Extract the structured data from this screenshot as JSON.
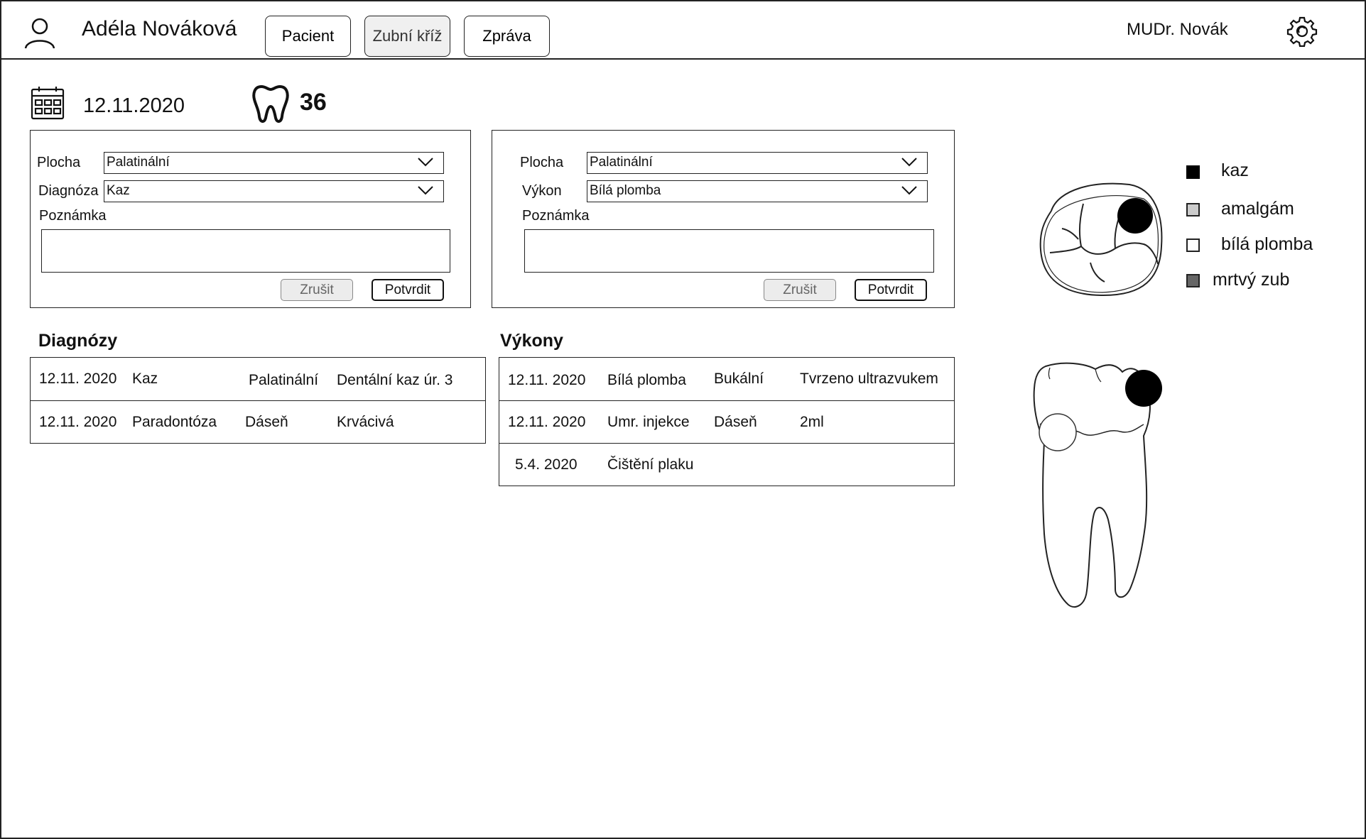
{
  "header": {
    "patient_name": "Adéla Nováková",
    "tabs": [
      {
        "label": "Pacient",
        "active": false
      },
      {
        "label": "Zubní kříž",
        "active": true
      },
      {
        "label": "Zpráva",
        "active": false
      }
    ],
    "doctor": "MUDr. Novák",
    "icons": [
      "user-icon",
      "gear-icon"
    ]
  },
  "visit": {
    "date": "12.11.2020",
    "tooth_number": "36",
    "icons": [
      "calendar-icon",
      "tooth-icon"
    ]
  },
  "diagnosis_form": {
    "surface_label": "Plocha",
    "surface_value": "Palatinální",
    "diagnosis_label": "Diagnóza",
    "diagnosis_value": "Kaz",
    "note_label": "Poznámka",
    "note_value": "",
    "cancel_label": "Zrušit",
    "confirm_label": "Potvrdit"
  },
  "procedure_form": {
    "surface_label": "Plocha",
    "surface_value": "Palatinální",
    "procedure_label": "Výkon",
    "procedure_value": "Bílá plomba",
    "note_label": "Poznámka",
    "note_value": "",
    "cancel_label": "Zrušit",
    "confirm_label": "Potvrdit"
  },
  "diagnoses": {
    "title": "Diagnózy",
    "rows": [
      {
        "date": "12.11. 2020",
        "name": "Kaz",
        "surface": "Palatinální",
        "detail": "Dentální kaz úr. 3"
      },
      {
        "date": "12.11. 2020",
        "name": "Paradontóza",
        "surface": "Dáseň",
        "detail": "Krvácivá"
      }
    ]
  },
  "procedures": {
    "title": "Výkony",
    "rows": [
      {
        "date": "12.11. 2020",
        "name": "Bílá plomba",
        "surface": "Bukální",
        "detail": "Tvrzeno ultrazvukem"
      },
      {
        "date": "12.11. 2020",
        "name": "Umr. injekce",
        "surface": "Dáseň",
        "detail": "2ml"
      },
      {
        "date": "5.4. 2020",
        "name": "Čištění plaku",
        "surface": "",
        "detail": ""
      }
    ]
  },
  "legend": [
    {
      "label": "kaz",
      "color": "#000000"
    },
    {
      "label": "amalgám",
      "color": "#cccccc"
    },
    {
      "label": "bílá plomba",
      "color": "#ffffff"
    },
    {
      "label": "mrtvý zub",
      "color": "#666666"
    }
  ]
}
